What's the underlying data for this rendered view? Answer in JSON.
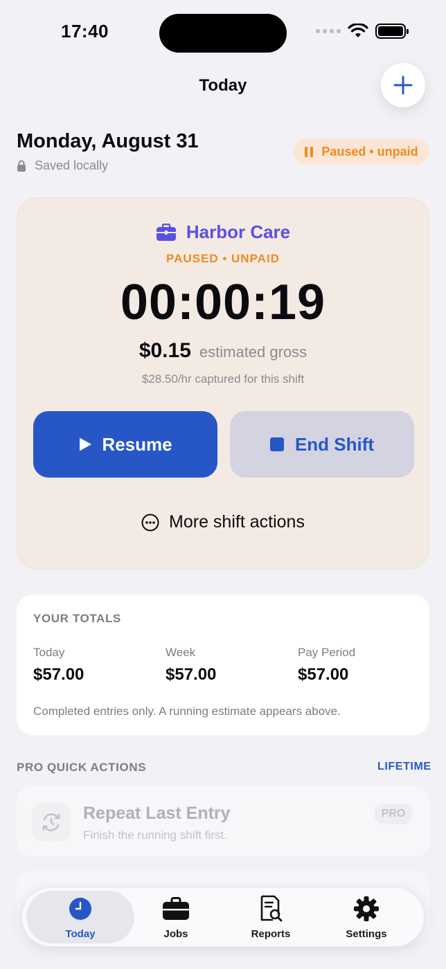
{
  "status_bar": {
    "time": "17:40"
  },
  "nav": {
    "title": "Today"
  },
  "header": {
    "date": "Monday, August 31",
    "saved_label": "Saved locally",
    "status_pill": "Paused • unpaid"
  },
  "shift": {
    "job_name": "Harbor Care",
    "status": "PAUSED • UNPAID",
    "timer": "00:00:19",
    "gross_amount": "$0.15",
    "gross_label": "estimated gross",
    "rate_note": "$28.50/hr captured for this shift",
    "resume_label": "Resume",
    "end_label": "End Shift",
    "more_label": "More shift actions"
  },
  "totals": {
    "heading": "YOUR TOTALS",
    "items": [
      {
        "label": "Today",
        "value": "$57.00"
      },
      {
        "label": "Week",
        "value": "$57.00"
      },
      {
        "label": "Pay Period",
        "value": "$57.00"
      }
    ],
    "note": "Completed entries only. A running estimate appears above."
  },
  "pro": {
    "heading": "PRO QUICK ACTIONS",
    "plan": "LIFETIME",
    "actions": [
      {
        "title": "Repeat Last Entry",
        "subtitle": "Finish the running shift first.",
        "badge": "PRO"
      }
    ]
  },
  "tabs": [
    {
      "label": "Today",
      "icon": "clock-icon",
      "active": true
    },
    {
      "label": "Jobs",
      "icon": "briefcase-icon",
      "active": false
    },
    {
      "label": "Reports",
      "icon": "report-search-icon",
      "active": false
    },
    {
      "label": "Settings",
      "icon": "gear-icon",
      "active": false
    }
  ],
  "colors": {
    "accent": "#2757c6",
    "job": "#5b50e0",
    "paused": "#f08a1c",
    "background": "#f2f1f6",
    "shift_card": "#f3eae4"
  }
}
